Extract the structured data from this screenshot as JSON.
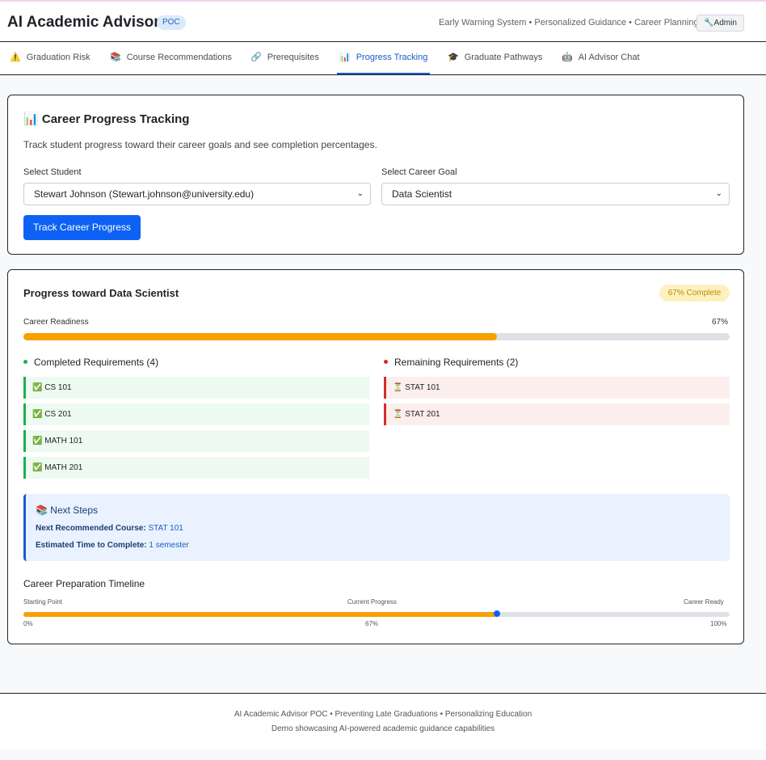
{
  "app": {
    "title": "AI Academic Advisor",
    "badge": "POC",
    "tagline": "Early Warning System • Personalized Guidance • Career Planning",
    "admin_label": "🔧Admin"
  },
  "tabs": [
    {
      "icon": "⚠️",
      "label": "Graduation Risk"
    },
    {
      "icon": "📚",
      "label": "Course Recommendations"
    },
    {
      "icon": "🔗",
      "label": "Prerequisites"
    },
    {
      "icon": "📊",
      "label": "Progress Tracking",
      "active": true
    },
    {
      "icon": "🎓",
      "label": "Graduate Pathways"
    },
    {
      "icon": "🤖",
      "label": "AI Advisor Chat"
    }
  ],
  "tracking": {
    "icon": "📊",
    "title": "Career Progress Tracking",
    "description": "Track student progress toward their career goals and see completion percentages.",
    "student_label": "Select Student",
    "student_value": "Stewart Johnson (Stewart.johnson@university.edu)",
    "goal_label": "Select Career Goal",
    "goal_value": "Data Scientist",
    "button": "Track Career Progress"
  },
  "progress": {
    "title": "Progress toward Data Scientist",
    "badge": "67% Complete",
    "readiness_label": "Career Readiness",
    "readiness_pct_text": "67%",
    "readiness_value": 67,
    "completed_title": "Completed Requirements (4)",
    "completed": [
      "CS 101",
      "CS 201",
      "MATH 101",
      "MATH 201"
    ],
    "completed_icon": "✅",
    "remaining_title": "Remaining Requirements (2)",
    "remaining": [
      "STAT 101",
      "STAT 201"
    ],
    "remaining_icon": "⏳",
    "colors": {
      "fill": "#f5a100",
      "track": "#dee2e6",
      "done": "#1fae4f",
      "todo": "#d52b2b",
      "accent": "#0d62f5"
    }
  },
  "next_steps": {
    "icon": "📚",
    "title": "Next Steps",
    "course_label": "Next Recommended Course:",
    "course_value": "STAT 101",
    "time_label": "Estimated Time to Complete:",
    "time_value": "1 semester"
  },
  "timeline": {
    "title": "Career Preparation Timeline",
    "start_label": "Starting Point",
    "current_label": "Current Progress",
    "end_label": "Career Ready",
    "start_pct": "0%",
    "current_pct": "67%",
    "end_pct": "100%",
    "value": 67
  },
  "footer": {
    "line1": "AI Academic Advisor POC • Preventing Late Graduations • Personalizing Education",
    "line2": "Demo showcasing AI-powered academic guidance capabilities"
  }
}
